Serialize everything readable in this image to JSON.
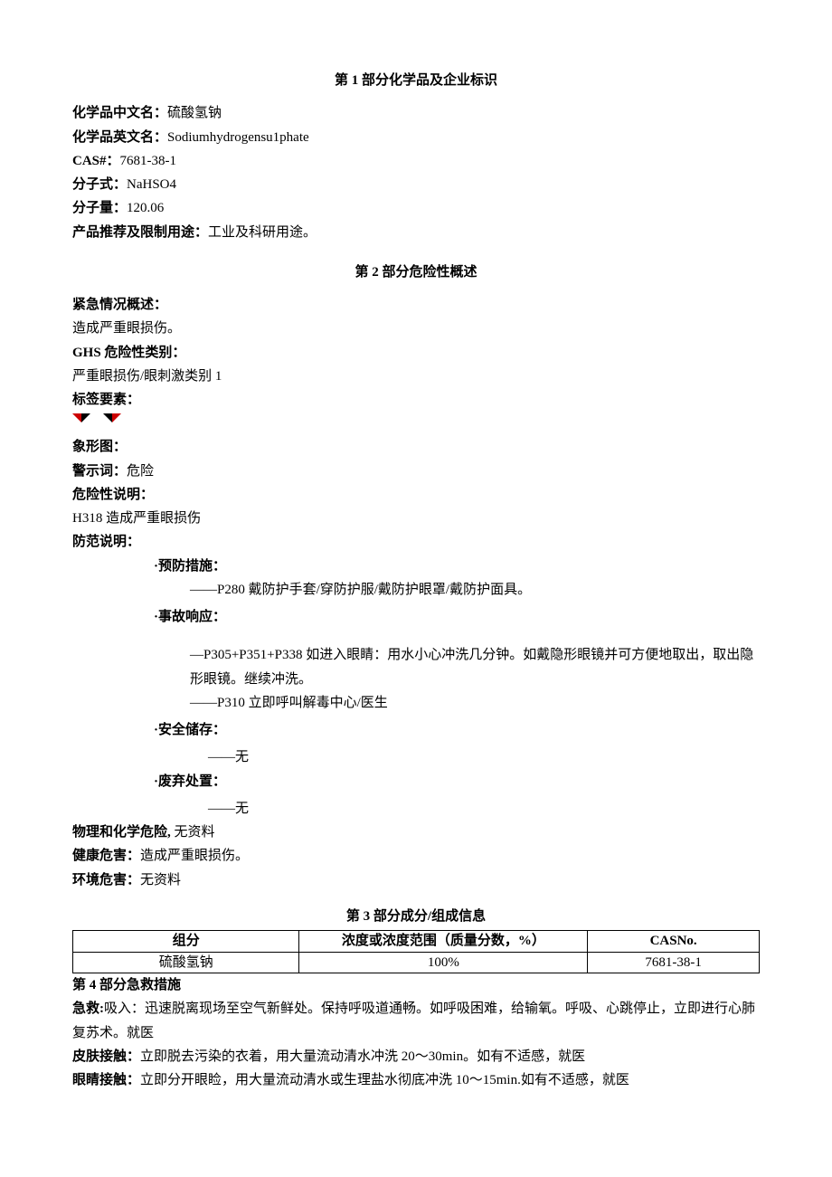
{
  "sec1": {
    "title": "第 1 部分化学品及企业标识",
    "name_cn_label": "化学品中文名：",
    "name_cn_value": "硫酸氢钠",
    "name_en_label": "化学品英文名：",
    "name_en_value": "Sodiumhydrogensu1phate",
    "cas_label": "CAS#：",
    "cas_value": "7681-38-1",
    "formula_label": "分子式：",
    "formula_value": "NaHSO4",
    "mw_label": "分子量：",
    "mw_value": "120.06",
    "use_label": "产品推荐及限制用途：",
    "use_value": "工业及科研用途。"
  },
  "sec2": {
    "title": "第 2 部分危险性概述",
    "emergency_label": "紧急情况概述：",
    "emergency_value": "造成严重眼损伤。",
    "ghs_label": "GHS 危险性类别：",
    "ghs_value": "严重眼损伤/眼刺激类别 1",
    "label_elements": "标签要素：",
    "pictogram_label": "象形图：",
    "signal_label": "警示词：",
    "signal_value": "危险",
    "hazard_label": "危险性说明：",
    "hazard_value": "H318 造成严重眼损伤",
    "precaution_label": "防范说明：",
    "prevent_heading": "·预防措施：",
    "prevent_item": "——P280 戴防护手套/穿防护服/戴防护眼罩/戴防护面具。",
    "response_heading": "·事故响应：",
    "response_item1": "—P305+P351+P338 如进入眼睛：用水小心冲洗几分钟。如戴隐形眼镜并可方便地取出，取出隐形眼镜。继续冲洗。",
    "response_item2": "——P310 立即呼叫解毒中心/医生",
    "storage_heading": "·安全储存：",
    "storage_item": "——无",
    "disposal_heading": "·废弃处置：",
    "disposal_item": "——无",
    "phys_label": "物理和化学危险, ",
    "phys_value": "无资料",
    "health_label": "健康危害：",
    "health_value": "造成严重眼损伤。",
    "env_label": "环境危害：",
    "env_value": "无资料"
  },
  "sec3": {
    "title": "第 3 部分成分/组成信息",
    "headers": {
      "component": "组分",
      "concentration": "浓度或浓度范围（质量分数，%）",
      "cas": "CASNo."
    },
    "row": {
      "component": "硫酸氢钠",
      "concentration": "100%",
      "cas": "7681-38-1"
    }
  },
  "sec4": {
    "title": "第 4 部分急救措施",
    "aid_label": "急救:",
    "inhale_label": "吸入：",
    "inhale_value": "迅速脱离现场至空气新鲜处。保持呼吸道通畅。如呼吸困难，给输氧。呼吸、心跳停止，立即进行心肺复苏术。就医",
    "skin_label": "皮肤接触：",
    "skin_value": "立即脱去污染的衣着，用大量流动清水冲洗 20～30min。如有不适感，就医",
    "eye_label": "眼睛接触：",
    "eye_value": "立即分开眼睑，用大量流动清水或生理盐水彻底冲洗 10～15min.如有不适感，就医"
  }
}
